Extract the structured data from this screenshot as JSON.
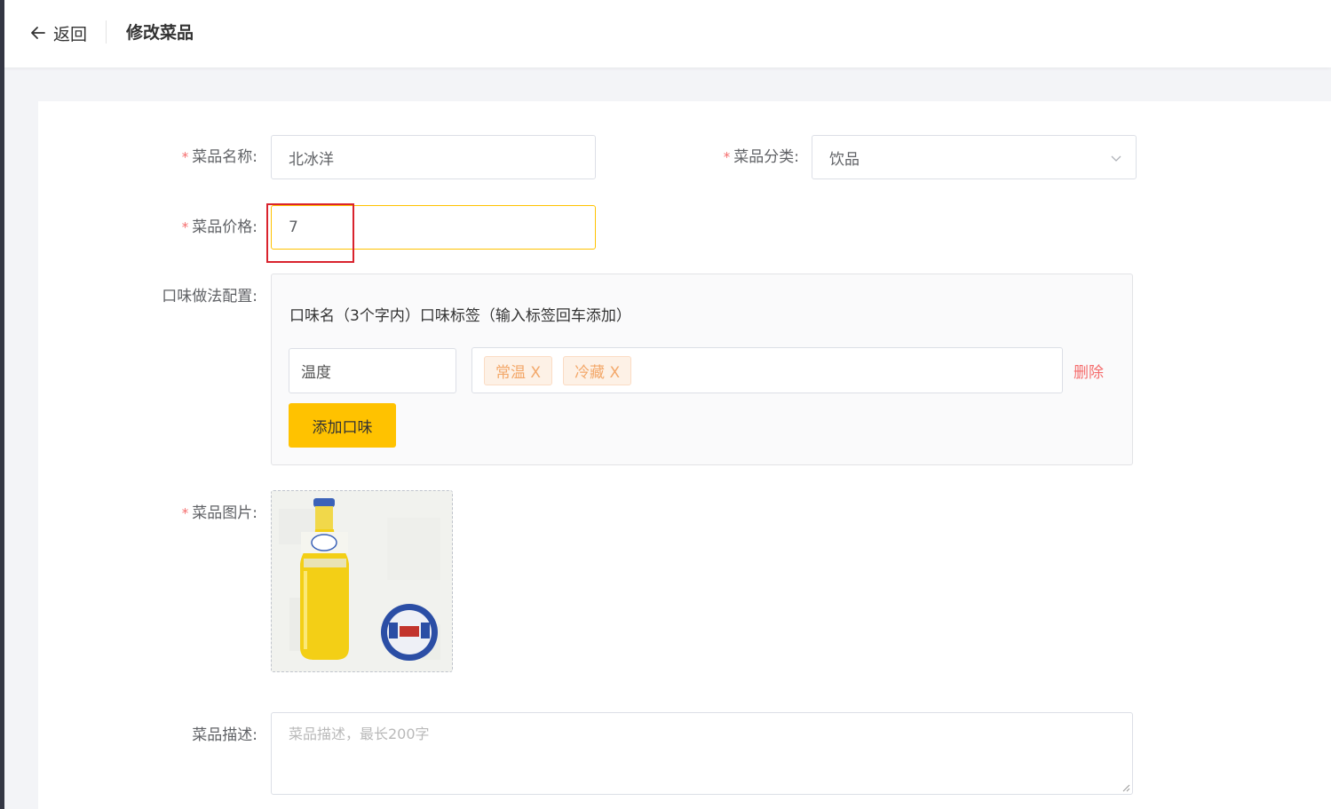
{
  "header": {
    "back_label": "返回",
    "title": "修改菜品"
  },
  "form": {
    "required_mark": "*",
    "name": {
      "label": "菜品名称:",
      "value": "北冰洋"
    },
    "category": {
      "label": "菜品分类:",
      "value": "饮品"
    },
    "price": {
      "label": "菜品价格:",
      "value": "7"
    },
    "flavor": {
      "label": "口味做法配置:",
      "header": "口味名（3个字内）口味标签（输入标签回车添加）",
      "items": [
        {
          "name": "温度",
          "tags": [
            "常温 X",
            "冷藏 X"
          ],
          "delete_label": "删除"
        }
      ],
      "add_button_label": "添加口味"
    },
    "image": {
      "label": "菜品图片:"
    },
    "description": {
      "label": "菜品描述:",
      "placeholder": "菜品描述，最长200字"
    }
  },
  "colors": {
    "accent": "#ffc200",
    "required": "#f56c6c",
    "tag_text": "#f3a86a",
    "tag_bg": "#fdf1e6",
    "highlight": "#d9232e",
    "sidebar": "#343744"
  },
  "icons": {
    "back": "arrow-left-icon",
    "select": "chevron-down-icon"
  }
}
